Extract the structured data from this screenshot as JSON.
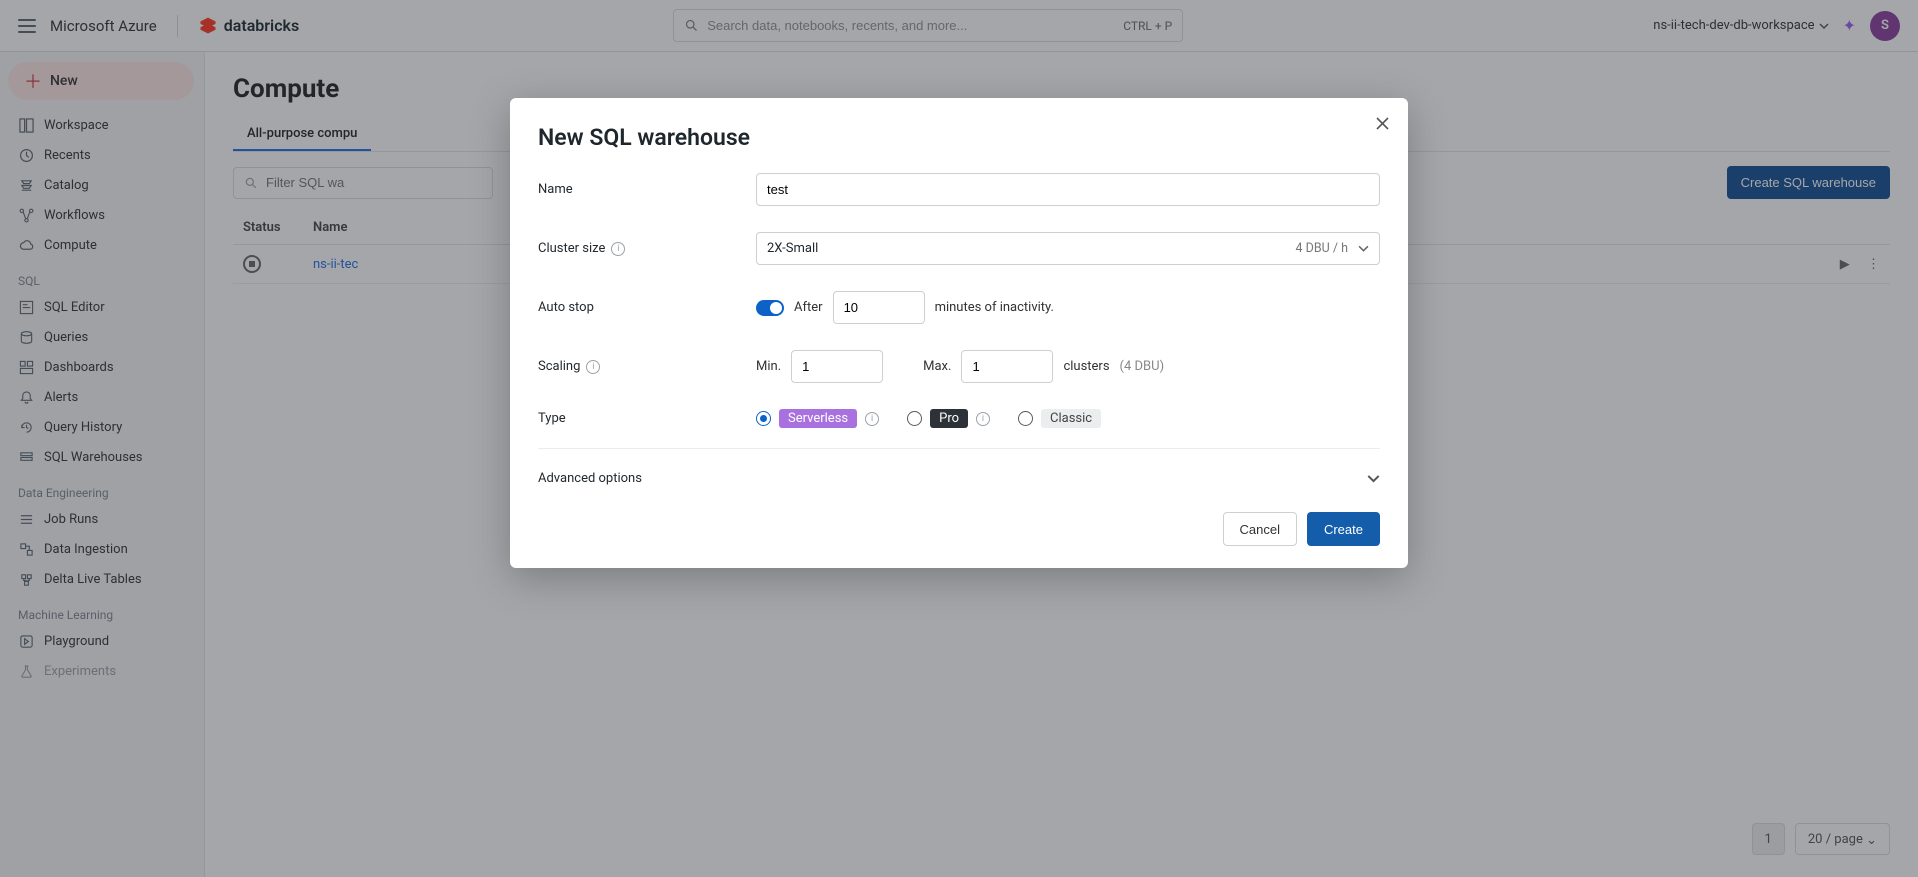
{
  "topbar": {
    "brand_azure": "Microsoft Azure",
    "brand_db": "databricks",
    "search_placeholder": "Search data, notebooks, recents, and more...",
    "search_shortcut": "CTRL + P",
    "workspace": "ns-ii-tech-dev-db-workspace",
    "avatar_initial": "S"
  },
  "sidebar": {
    "new_label": "New",
    "primary": [
      {
        "label": "Workspace"
      },
      {
        "label": "Recents"
      },
      {
        "label": "Catalog"
      },
      {
        "label": "Workflows"
      },
      {
        "label": "Compute"
      }
    ],
    "sections": [
      {
        "title": "SQL",
        "items": [
          "SQL Editor",
          "Queries",
          "Dashboards",
          "Alerts",
          "Query History",
          "SQL Warehouses"
        ]
      },
      {
        "title": "Data Engineering",
        "items": [
          "Job Runs",
          "Data Ingestion",
          "Delta Live Tables"
        ]
      },
      {
        "title": "Machine Learning",
        "items": [
          "Playground",
          "Experiments"
        ]
      }
    ]
  },
  "main": {
    "title": "Compute",
    "tab_visible": "All-purpose compu",
    "filter_placeholder": "Filter SQL wa",
    "create_button": "Create SQL warehouse",
    "columns": [
      "Status",
      "Name"
    ],
    "rows": [
      {
        "status": "stopped",
        "name": "ns-ii-tec"
      }
    ],
    "page_number": "1",
    "page_size": "20 / page"
  },
  "modal": {
    "title": "New SQL warehouse",
    "labels": {
      "name": "Name",
      "cluster_size": "Cluster size",
      "auto_stop": "Auto stop",
      "scaling": "Scaling",
      "type": "Type",
      "advanced": "Advanced options"
    },
    "name_value": "test",
    "cluster_size_value": "2X-Small",
    "cluster_size_meta": "4 DBU / h",
    "auto_stop_after": "After",
    "auto_stop_value": "10",
    "auto_stop_suffix": "minutes of inactivity.",
    "scaling_min_label": "Min.",
    "scaling_min_value": "1",
    "scaling_max_label": "Max.",
    "scaling_max_value": "1",
    "scaling_suffix_a": "clusters",
    "scaling_suffix_b": "(4 DBU)",
    "type_options": {
      "serverless": "Serverless",
      "pro": "Pro",
      "classic": "Classic"
    },
    "buttons": {
      "cancel": "Cancel",
      "create": "Create"
    }
  }
}
